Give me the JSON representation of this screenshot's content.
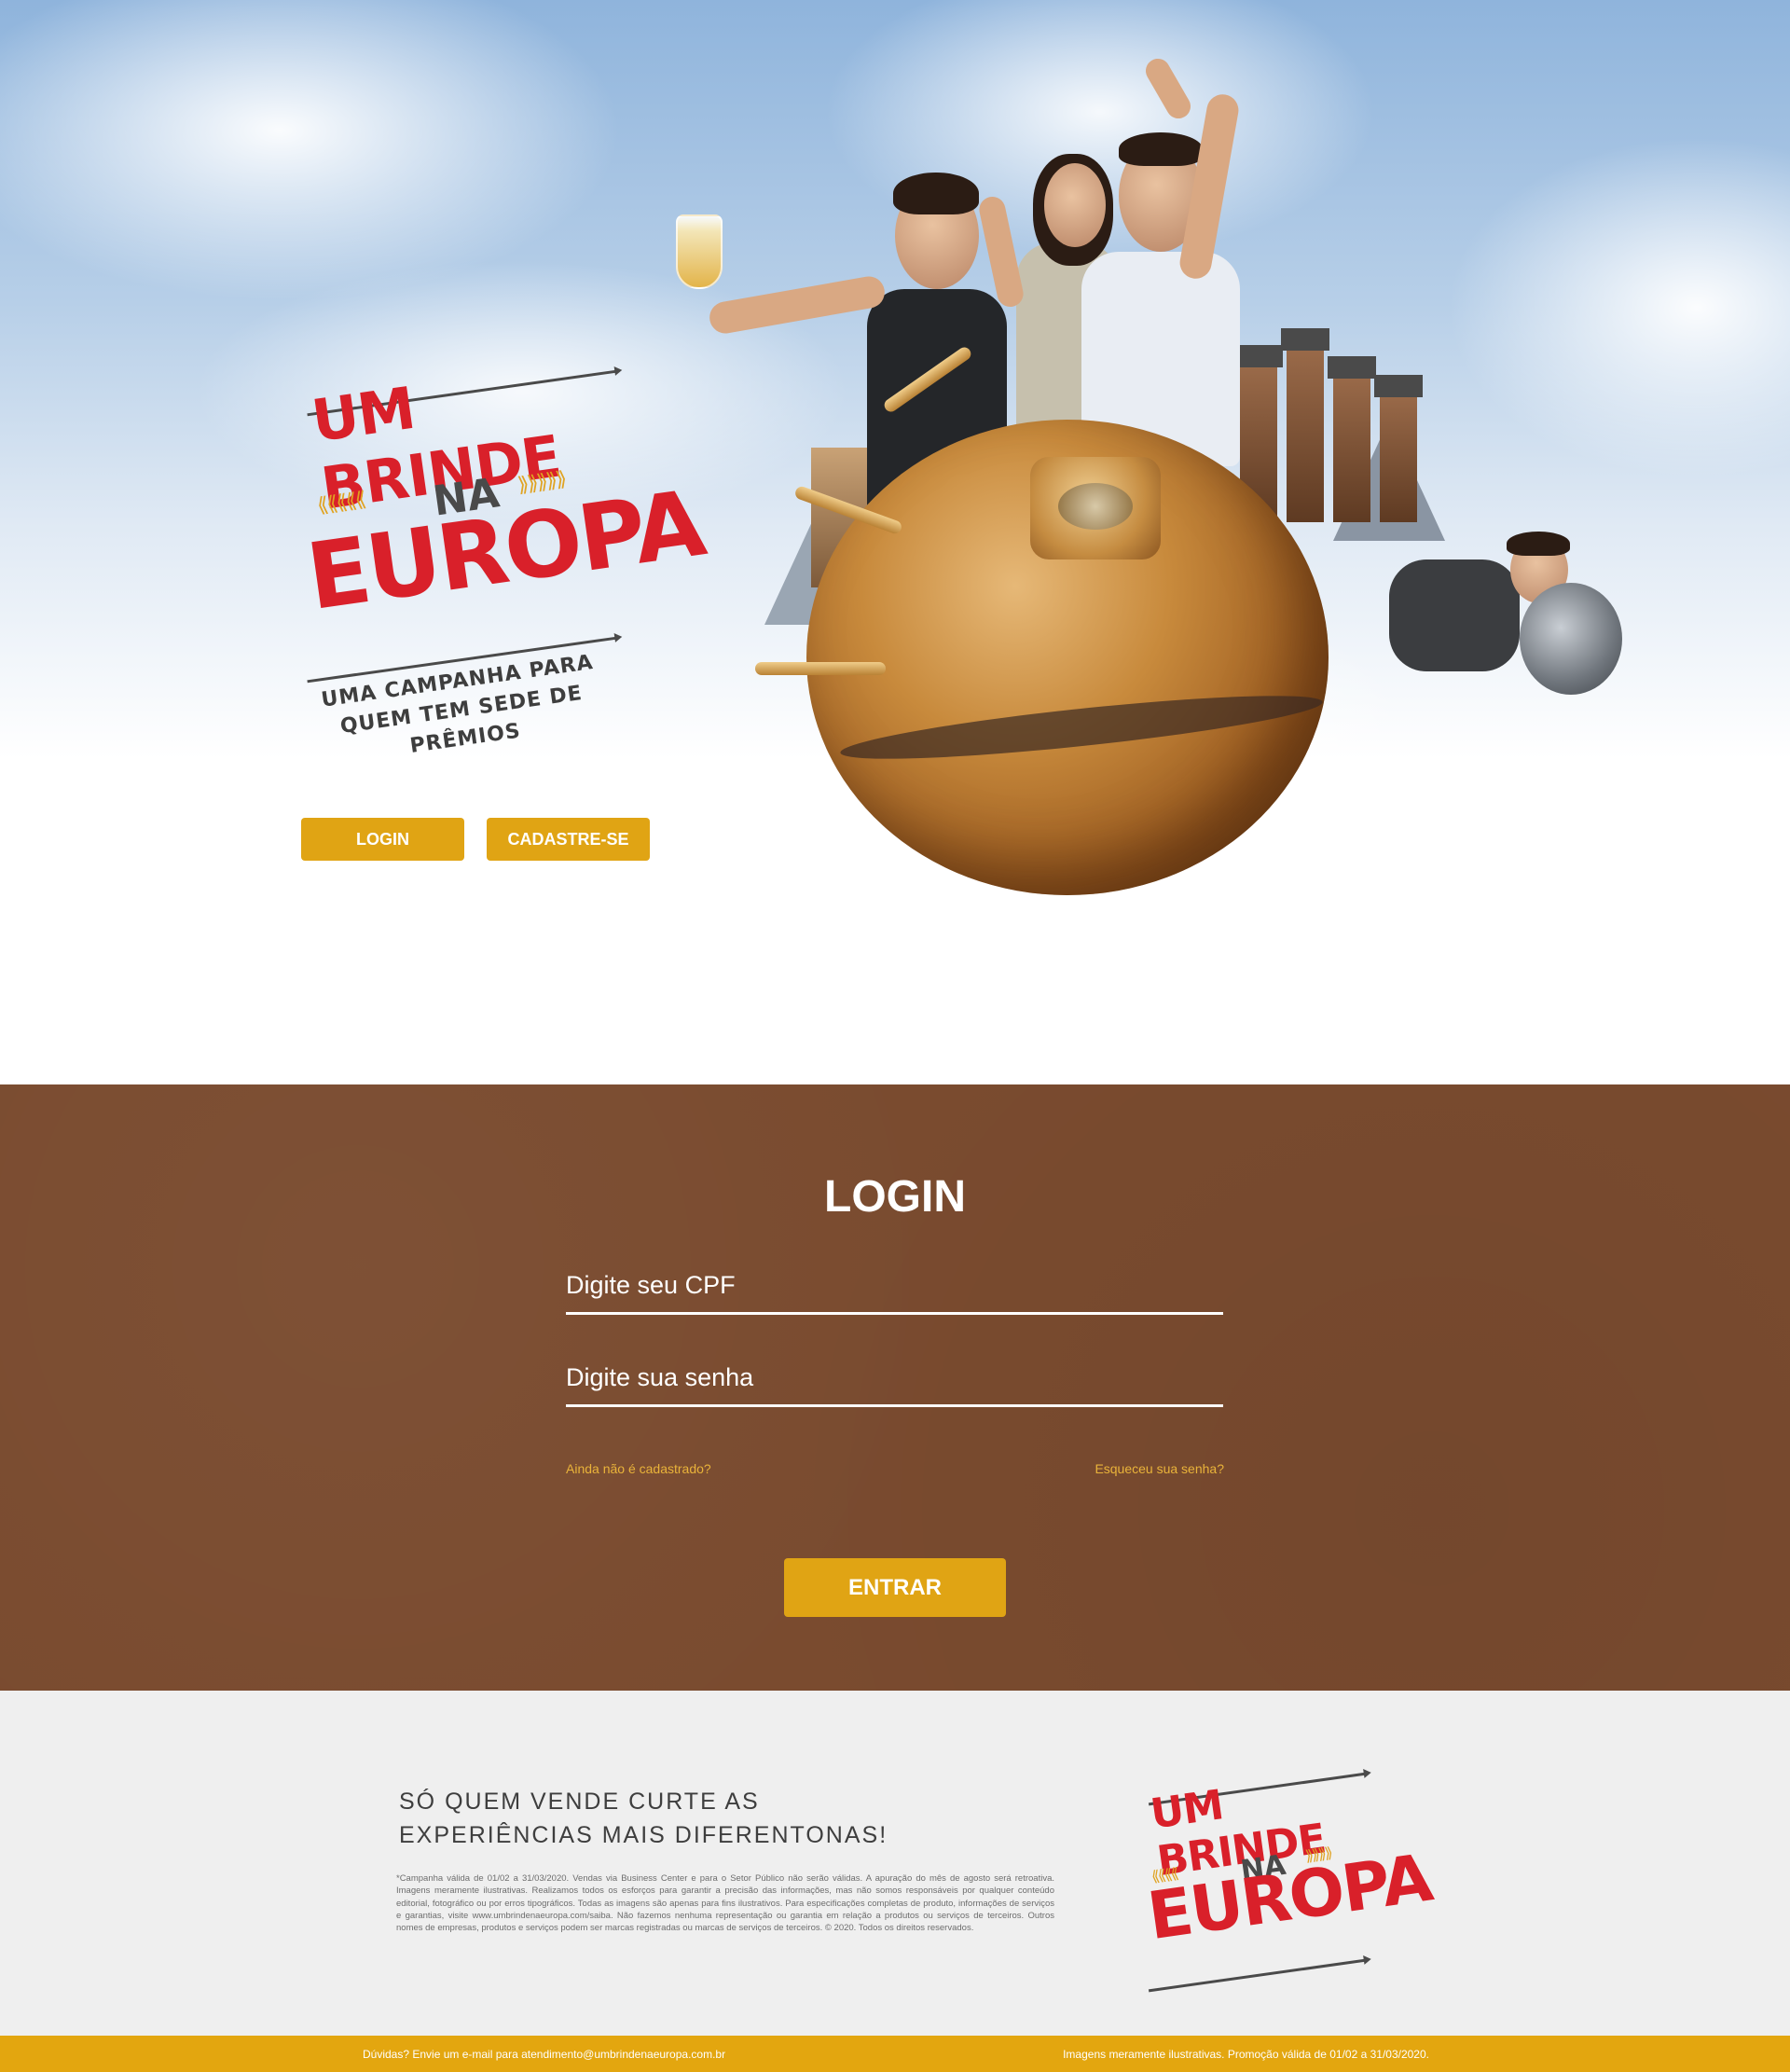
{
  "hero": {
    "logo": {
      "line1": "UM BRINDE",
      "line2": "NA",
      "line3": "EUROPA",
      "tagline_1": "UMA CAMPANHA PARA",
      "tagline_2": "QUEM TEM SEDE DE PRÊMIOS"
    },
    "buttons": {
      "login_label": "LOGIN",
      "register_label": "CADASTRE-SE"
    }
  },
  "login": {
    "title": "LOGIN",
    "cpf_placeholder": "Digite seu CPF",
    "password_placeholder": "Digite sua senha",
    "not_registered_link": "Ainda não é cadastrado?",
    "forgot_password_link": "Esqueceu sua senha?",
    "submit_label": "ENTRAR"
  },
  "footer": {
    "headline_1": "SÓ QUEM VENDE CURTE AS",
    "headline_2": "EXPERIÊNCIAS MAIS DIFERENTONAS!",
    "legal": "*Campanha válida de 01/02 a 31/03/2020. Vendas via Business Center e para o Setor Público não serão válidas. A apuração do mês de agosto será retroativa. Imagens meramente ilustrativas. Realizamos todos os esforços para garantir a precisão das informações, mas não somos responsáveis por qualquer conteúdo editorial, fotográfico ou por erros tipográficos. Todas as imagens são apenas para fins ilustrativos. Para especificações completas de produto, informações de serviços e garantias, visite www.umbrindenaeuropa.com/saiba. Não fazemos nenhuma representação ou garantia em relação a produtos ou serviços de terceiros. Outros nomes de empresas, produtos e serviços podem ser marcas registradas ou marcas de serviços de terceiros. © 2020. Todos os direitos reservados.",
    "logo": {
      "line1": "UM BRINDE",
      "line2": "NA",
      "line3": "EUROPA"
    }
  },
  "bottom_bar": {
    "contact_prefix": "Dúvidas? Envie um e-mail para",
    "contact_email": "atendimento@umbrindenaeuropa.com.br",
    "disclaimer": "Imagens meramente ilustrativas. Promoção válida de 01/02 a 31/03/2020."
  },
  "colors": {
    "accent_yellow": "#e0a414",
    "brand_red": "#d9202a",
    "login_bg_brown": "#7a4b2f",
    "footer_bg": "#efefef"
  }
}
